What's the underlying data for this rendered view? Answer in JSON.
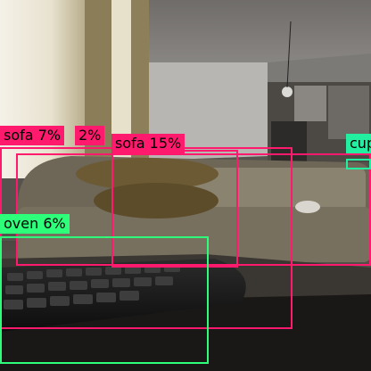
{
  "colors": {
    "sofa": "#ff1a6e",
    "oven": "#2dff7a",
    "cup": "#22f0a0"
  },
  "detections": [
    {
      "label": "sofa 7%",
      "class": "sofa"
    },
    {
      "label": "2%",
      "class": "sofa"
    },
    {
      "label": "sofa 15%",
      "class": "sofa"
    },
    {
      "label": "oven 6%",
      "class": "oven"
    },
    {
      "label": "cup",
      "class": "cup"
    }
  ]
}
